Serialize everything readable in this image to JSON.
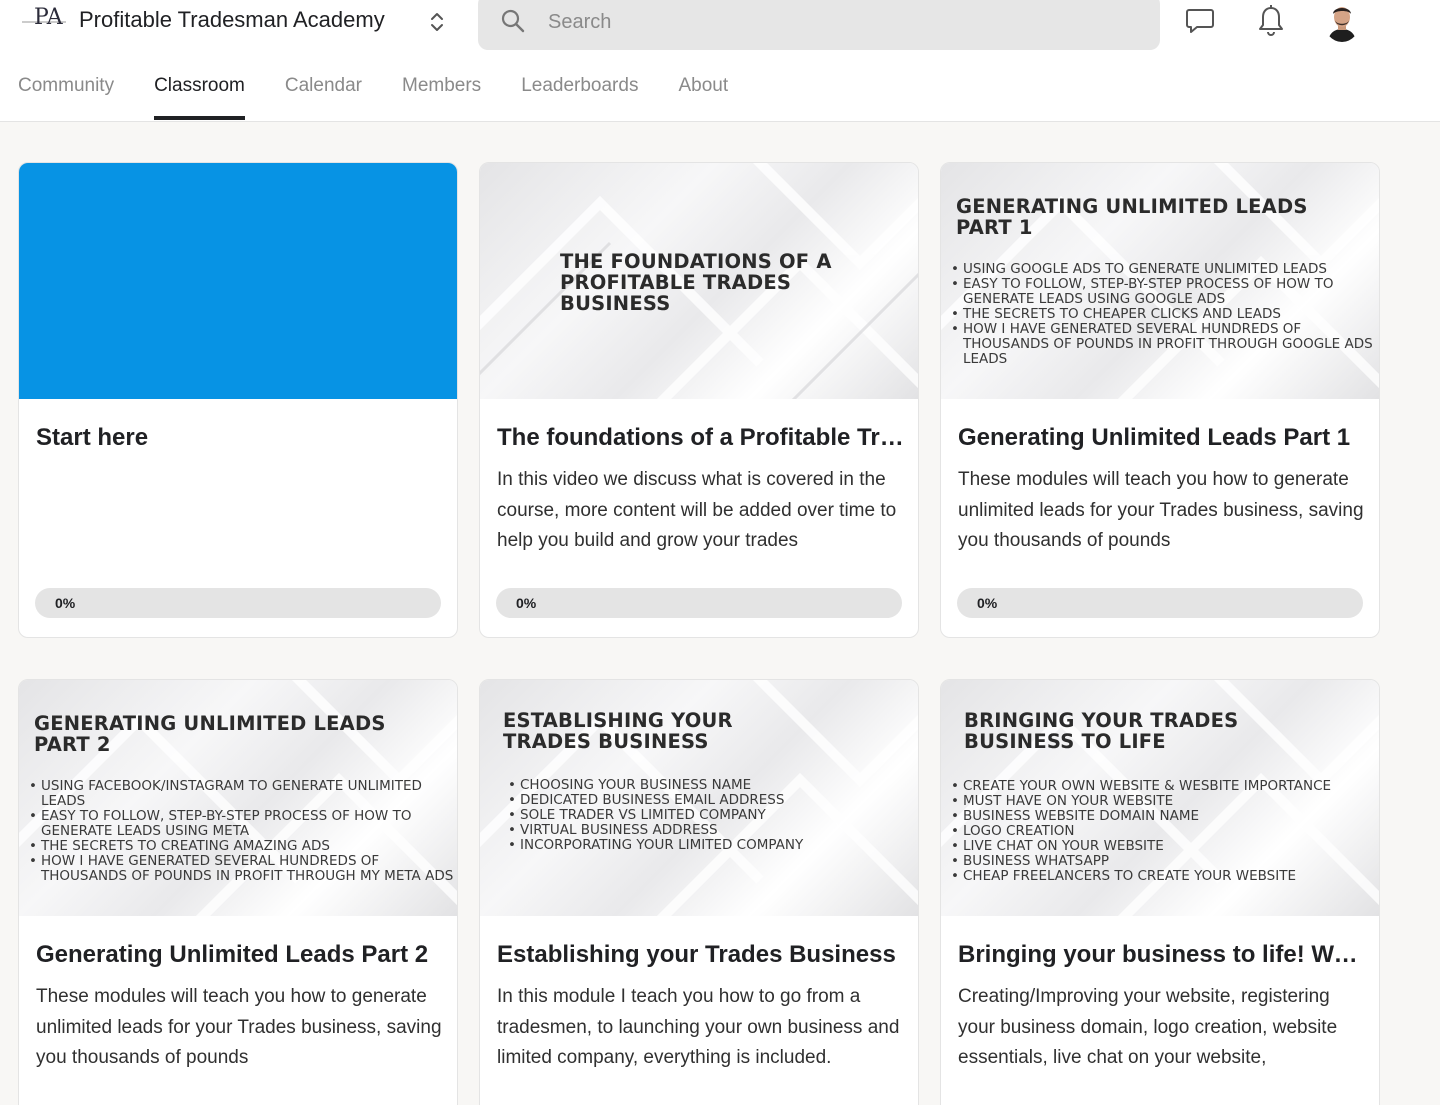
{
  "header": {
    "group_name": "Profitable Tradesman Academy",
    "logo_text": "PA",
    "search_placeholder": "Search",
    "icons": [
      "logo-icon",
      "chevron-up-down-icon",
      "search-icon",
      "chat-icon",
      "bell-icon",
      "avatar"
    ]
  },
  "tabs": [
    {
      "label": "Community",
      "active": false
    },
    {
      "label": "Classroom",
      "active": true
    },
    {
      "label": "Calendar",
      "active": false
    },
    {
      "label": "Members",
      "active": false
    },
    {
      "label": "Leaderboards",
      "active": false
    },
    {
      "label": "About",
      "active": false
    }
  ],
  "colors": {
    "accent": "#0793e4",
    "text": "#202124",
    "muted": "#8a8a8a",
    "background": "#f8f7f5"
  },
  "courses": [
    {
      "title": "Start here",
      "description": "",
      "progress_label": "0%",
      "progress": 0,
      "thumb": {
        "type": "solid",
        "title": "",
        "items": []
      }
    },
    {
      "title": "The foundations of a Profitable Trades Business",
      "description": "In this video we discuss what is covered in the course, more content will be added over time to help you build and grow your trades",
      "progress_label": "0%",
      "progress": 0,
      "thumb": {
        "type": "image",
        "title": "THE FOUNDATIONS OF A PROFITABLE TRADES BUSINESS",
        "items": []
      }
    },
    {
      "title": "Generating Unlimited Leads Part 1",
      "description": "These modules will teach you how to generate unlimited leads for your Trades business, saving you thousands of pounds",
      "progress_label": "0%",
      "progress": 0,
      "thumb": {
        "type": "image",
        "title": "GENERATING UNLIMITED LEADS PART 1",
        "items": [
          "USING GOOGLE ADS TO GENERATE UNLIMITED LEADS",
          "EASY TO FOLLOW, STEP-BY-STEP PROCESS OF HOW TO GENERATE LEADS USING GOOGLE ADS",
          "THE SECRETS TO CHEAPER CLICKS AND LEADS",
          "HOW I HAVE GENERATED SEVERAL HUNDREDS OF THOUSANDS OF POUNDS IN PROFIT THROUGH GOOGLE ADS LEADS"
        ]
      }
    },
    {
      "title": "Generating Unlimited Leads Part 2",
      "description": "These modules will teach you how to generate unlimited leads for your Trades business, saving you thousands of pounds",
      "progress_label": "0%",
      "progress": 0,
      "thumb": {
        "type": "image",
        "title": "GENERATING UNLIMITED LEADS PART 2",
        "items": [
          "USING FACEBOOK/INSTAGRAM TO GENERATE UNLIMITED LEADS",
          "EASY TO FOLLOW, STEP-BY-STEP PROCESS OF HOW TO GENERATE LEADS USING META",
          "THE SECRETS TO CREATING AMAZING ADS",
          "HOW I HAVE GENERATED SEVERAL HUNDREDS OF THOUSANDS OF POUNDS IN PROFIT THROUGH MY META ADS"
        ]
      }
    },
    {
      "title": "Establishing your Trades Business",
      "description": "In this module I teach you how to go from a tradesmen, to launching your own business and limited company, everything is included.",
      "progress_label": "0%",
      "progress": 0,
      "thumb": {
        "type": "image",
        "title": "ESTABLISHING YOUR TRADES BUSINESS",
        "items": [
          "CHOOSING YOUR BUSINESS NAME",
          "DEDICATED BUSINESS EMAIL ADDRESS",
          "SOLE TRADER VS LIMITED COMPANY",
          "VIRTUAL BUSINESS ADDRESS",
          "INCORPORATING YOUR LIMITED COMPANY"
        ]
      }
    },
    {
      "title": "Bringing your business to life! Website, domain, logo and more",
      "description": "Creating/Improving your website, registering your business domain, logo creation, website essentials, live chat on your website,",
      "progress_label": "0%",
      "progress": 0,
      "thumb": {
        "type": "image",
        "title": "BRINGING YOUR TRADES BUSINESS TO LIFE",
        "items": [
          "CREATE YOUR OWN WEBSITE & WESBITE IMPORTANCE",
          "MUST HAVE ON YOUR WEBSITE",
          "BUSINESS WEBSITE DOMAIN NAME",
          "LOGO CREATION",
          "LIVE CHAT ON YOUR WEBSITE",
          "BUSINESS WHATSAPP",
          "CHEAP FREELANCERS TO CREATE YOUR WEBSITE"
        ]
      }
    }
  ]
}
